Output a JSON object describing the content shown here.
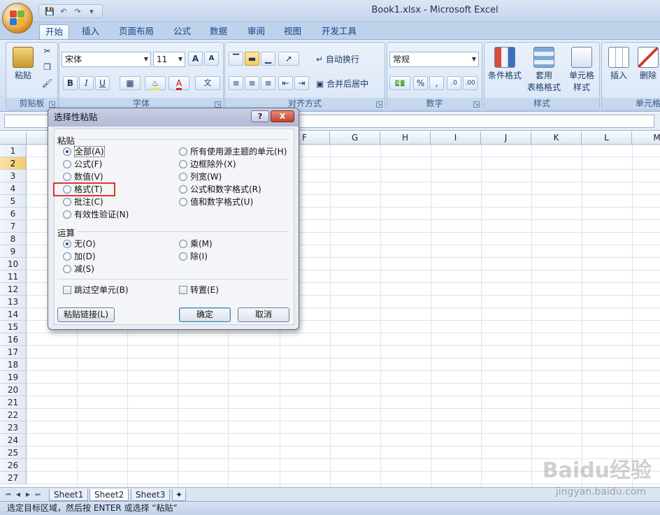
{
  "window": {
    "title": "Book1.xlsx - Microsoft Excel"
  },
  "ribbon_tabs": [
    "开始",
    "插入",
    "页面布局",
    "公式",
    "数据",
    "审阅",
    "视图",
    "开发工具"
  ],
  "clipboard": {
    "paste_label": "粘贴",
    "group_label": "剪贴板"
  },
  "font": {
    "name": "宋体",
    "size": "11",
    "group_label": "字体",
    "bold": "B",
    "italic": "I",
    "underline": "U",
    "grow": "A",
    "shrink": "A",
    "pinyin": "文"
  },
  "alignment": {
    "wrap_label": "自动换行",
    "merge_label": "合并后居中",
    "group_label": "对齐方式"
  },
  "number": {
    "format": "常规",
    "group_label": "数字",
    "percent": "%",
    "comma": ","
  },
  "styles": {
    "conditional_label": "条件格式",
    "table_label_1": "套用",
    "table_label_2": "表格格式",
    "cell_label_1": "单元格",
    "cell_label_2": "样式",
    "group_label": "样式"
  },
  "cells": {
    "insert_label": "插入",
    "delete_label": "删除",
    "group_label": "单元格"
  },
  "columns": [
    "F",
    "G",
    "H",
    "I",
    "J",
    "K",
    "L",
    "M"
  ],
  "rows": [
    "1",
    "2",
    "3",
    "4",
    "5",
    "6",
    "7",
    "8",
    "9",
    "10",
    "11",
    "12",
    "13",
    "14",
    "15",
    "16",
    "17",
    "18",
    "19",
    "20",
    "21",
    "22",
    "23",
    "24",
    "25",
    "26",
    "27"
  ],
  "selected_row": "2",
  "sheets": [
    "Sheet1",
    "Sheet2",
    "Sheet3"
  ],
  "active_sheet": "Sheet2",
  "status_text": "选定目标区域，然后按 ENTER 或选择 “粘贴”",
  "watermark": "Baidu经验",
  "watermark_url": "jingyan.baidu.com",
  "dialog": {
    "title": "选择性粘贴",
    "help": "?",
    "close": "X",
    "paste_section": "粘贴",
    "paste_options_left": [
      "全部(A)",
      "公式(F)",
      "数值(V)",
      "格式(T)",
      "批注(C)",
      "有效性验证(N)"
    ],
    "paste_options_right": [
      "所有使用源主题的单元(H)",
      "边框除外(X)",
      "列宽(W)",
      "公式和数字格式(R)",
      "值和数字格式(U)"
    ],
    "paste_selected": "全部(A)",
    "operation_section": "运算",
    "operation_options_left": [
      "无(O)",
      "加(D)",
      "减(S)"
    ],
    "operation_options_right": [
      "乘(M)",
      "除(I)"
    ],
    "operation_selected": "无(O)",
    "skip_blanks": "跳过空单元(B)",
    "transpose": "转置(E)",
    "paste_link_button": "粘贴链接(L)",
    "ok_button": "确定",
    "cancel_button": "取消"
  }
}
